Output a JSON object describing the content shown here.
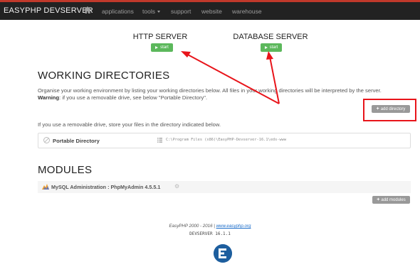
{
  "nav": {
    "brand": "EASYPHP DEVSERVER",
    "home_icon": "home-icon",
    "links": [
      "applications",
      "tools",
      "support",
      "website",
      "warehouse"
    ]
  },
  "servers": {
    "http_title": "HTTP SERVER",
    "http_start": "start",
    "db_title": "DATABASE SERVER",
    "db_start": "start"
  },
  "working": {
    "heading": "WORKING DIRECTORIES",
    "description": "Organise your working environment by listing your working directories below. All files in your working directories will be interpreted by the server.",
    "warning_label": "Warning",
    "warning_text": ": if you use a removable drive, see below \"Portable Directory\".",
    "add_directory": "add directory",
    "removable_note": "If you use a removable drive, store your files in the directory indicated below.",
    "portable_label": "Portable Directory",
    "portable_path": "C:\\Program Files (x86)\\EasyPHP-Devserver-16.1\\eds-www"
  },
  "modules": {
    "heading": "MODULES",
    "item_label": "MySQL Administration : PhpMyAdmin 4.5.5.1",
    "add_modules": "add modules"
  },
  "footer": {
    "copyright": "EasyPHP 2000 - 2016 | ",
    "site_link": "www.easyphp.org",
    "version": "DEVSERVER 16.1.1"
  },
  "colors": {
    "navbar": "#222222",
    "start_green": "#5cb85c",
    "annotation_red": "#e8141a",
    "logo_blue": "#1d5e9e"
  }
}
